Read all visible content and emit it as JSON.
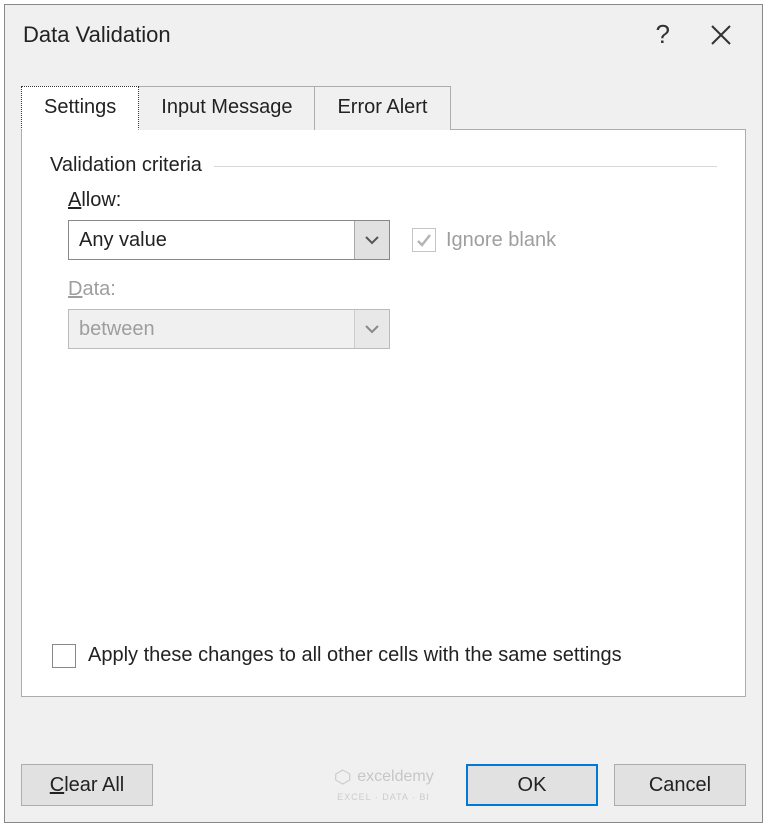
{
  "dialog": {
    "title": "Data Validation"
  },
  "tabs": {
    "settings": "Settings",
    "input_message": "Input Message",
    "error_alert": "Error Alert"
  },
  "panel": {
    "criteria_label": "Validation criteria",
    "allow_label": "Allow:",
    "allow_value": "Any value",
    "data_label": "Data:",
    "data_value": "between",
    "ignore_blank_label": "Ignore blank",
    "apply_changes_label": "Apply these changes to all other cells with the same settings"
  },
  "buttons": {
    "clear_all": "Clear All",
    "ok": "OK",
    "cancel": "Cancel"
  },
  "watermark": {
    "brand": "exceldemy",
    "tagline": "EXCEL · DATA · BI"
  }
}
